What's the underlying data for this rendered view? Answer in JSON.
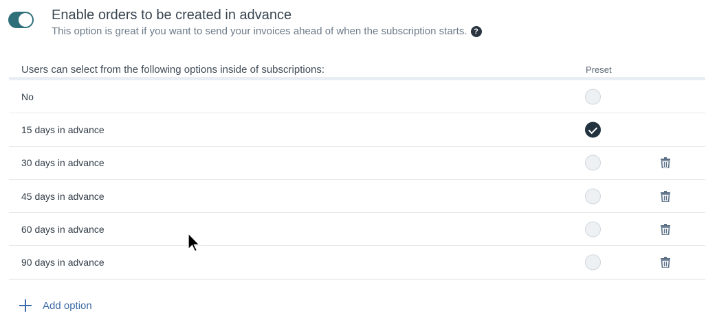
{
  "setting": {
    "enabled": true,
    "title": "Enable orders to be created in advance",
    "subtitle": "This option is great if you want to send your invoices ahead of when the subscription starts.",
    "help_icon": "?"
  },
  "table": {
    "header_options": "Users can select from the following options inside of subscriptions:",
    "header_preset": "Preset",
    "rows": [
      {
        "label": "No",
        "preset": false,
        "deletable": false
      },
      {
        "label": "15 days in advance",
        "preset": true,
        "deletable": false
      },
      {
        "label": "30 days in advance",
        "preset": false,
        "deletable": true
      },
      {
        "label": "45 days in advance",
        "preset": false,
        "deletable": true
      },
      {
        "label": "60 days in advance",
        "preset": false,
        "deletable": true
      },
      {
        "label": "90 days in advance",
        "preset": false,
        "deletable": true
      }
    ]
  },
  "add_option": {
    "label": "Add option"
  },
  "colors": {
    "toggle": "#2f6f7a",
    "link": "#3d6aa6",
    "checked": "#22323f"
  }
}
